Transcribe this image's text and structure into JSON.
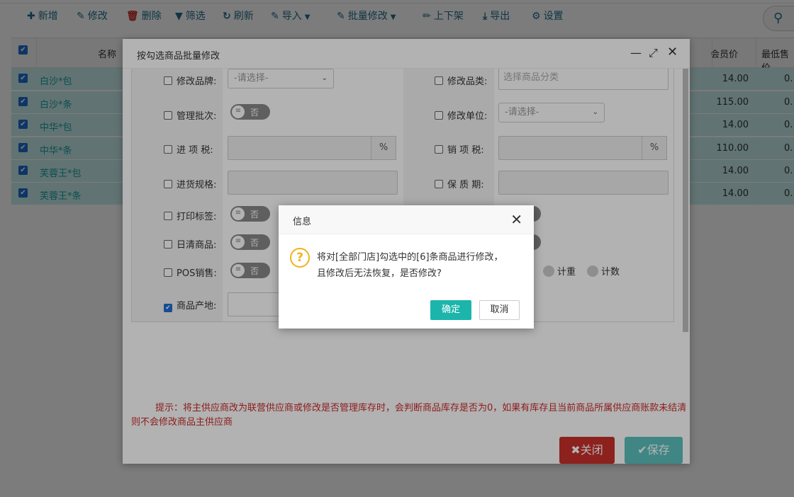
{
  "toolbar": {
    "add": "新增",
    "edit": "修改",
    "delete": "删除",
    "filter": "筛选",
    "refresh": "刷新",
    "import": "导入",
    "batch_edit": "批量修改",
    "shelf": "上下架",
    "export": "导出",
    "settings": "设置"
  },
  "grid": {
    "headers": {
      "name": "名称",
      "member_price": "会员价",
      "min_price": "最低售价"
    },
    "rows": [
      {
        "name": "白沙*包",
        "member_price": "14.00",
        "min_price": "0."
      },
      {
        "name": "白沙*条",
        "member_price": "115.00",
        "min_price": "0."
      },
      {
        "name": "中华*包",
        "member_price": "14.00",
        "min_price": "0."
      },
      {
        "name": "中华*条",
        "member_price": "110.00",
        "min_price": "0."
      },
      {
        "name": "芙蓉王*包",
        "member_price": "14.00",
        "min_price": "0."
      },
      {
        "name": "芙蓉王*条",
        "member_price": "14.00",
        "min_price": "0."
      }
    ]
  },
  "batch_window": {
    "title": "按勾选商品批量修改",
    "fields": {
      "brand_label": "修改品牌:",
      "brand_placeholder": "-请选择-",
      "category_label": "修改品类:",
      "category_placeholder": "选择商品分类",
      "batch_label": "管理批次:",
      "batch_toggle": "否",
      "unit_label": "修改单位:",
      "unit_placeholder": "-请选择-",
      "in_tax_label": "进 项 税:",
      "in_tax_unit": "%",
      "out_tax_label": "销 项 税:",
      "out_tax_unit": "%",
      "spec_label": "进货规格:",
      "shelf_life_label": "保 质 期:",
      "print_label_label": "打印标签:",
      "print_label_toggle": "否",
      "daily_clear_label": "日清商品:",
      "daily_clear_toggle": "否",
      "pos_label": "POS销售:",
      "pos_toggle": "否",
      "weigh_option": "计重",
      "count_option": "计数",
      "origin_label": "商品产地:"
    },
    "tip": "提示：将主供应商改为联营供应商或修改是否管理库存时，会判断商品库存是否为0，如果有库存且当前商品所属供应商账款未结清则不会修改商品主供应商",
    "close_label": "关闭",
    "save_label": "保存"
  },
  "confirm_dialog": {
    "title": "信息",
    "message_line1": "将对[全部门店]勾选中的[6]条商品进行修改，",
    "message_line2": "且修改后无法恢复，是否修改?",
    "ok_label": "确定",
    "cancel_label": "取消"
  },
  "colors": {
    "teal_accent": "#1bb5ac",
    "row_highlight": "#c9ecec",
    "close_red": "#c9302c",
    "save_teal": "#5bc0be",
    "tip_red": "#cc2a2a"
  }
}
